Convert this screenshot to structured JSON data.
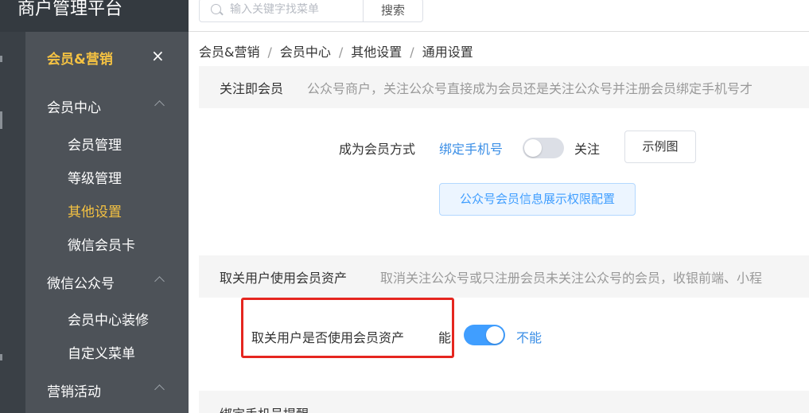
{
  "app": {
    "title": "商户管理平台"
  },
  "search": {
    "placeholder": "输入关键字找菜单",
    "button_label": "搜索"
  },
  "sidebar": {
    "header": "会员&营销",
    "close_icon": "×",
    "groups": [
      {
        "label": "会员中心",
        "items": [
          "会员管理",
          "等级管理",
          "其他设置",
          "微信会员卡"
        ]
      },
      {
        "label": "微信公众号",
        "items": [
          "会员中心装修",
          "自定义菜单"
        ]
      },
      {
        "label": "营销活动",
        "items": []
      }
    ],
    "active_item": "其他设置"
  },
  "breadcrumb": {
    "items": [
      "会员&营销",
      "会员中心",
      "其他设置",
      "通用设置"
    ],
    "separator": "/"
  },
  "section1": {
    "title": "关注即会员",
    "description": "公众号商户，关注公众号直接成为会员还是关注公众号并注册会员绑定手机号才",
    "field_label": "成为会员方式",
    "option_left": "绑定手机号",
    "option_right": "关注",
    "toggle_on": false,
    "example_button": "示例图",
    "config_button": "公众号会员信息展示权限配置"
  },
  "section2": {
    "title": "取关用户使用会员资产",
    "description": "取消关注公众号或只注册会员未关注公众号的会员，收银前端、小程",
    "field_label": "取关用户是否使用会员资产",
    "option_left": "能",
    "option_right": "不能",
    "toggle_on": true
  },
  "section3": {
    "title": "绑定手机号提醒"
  },
  "colors": {
    "accent": "#409eff",
    "active_menu": "#f5c242",
    "highlight_box": "#e5261f"
  }
}
